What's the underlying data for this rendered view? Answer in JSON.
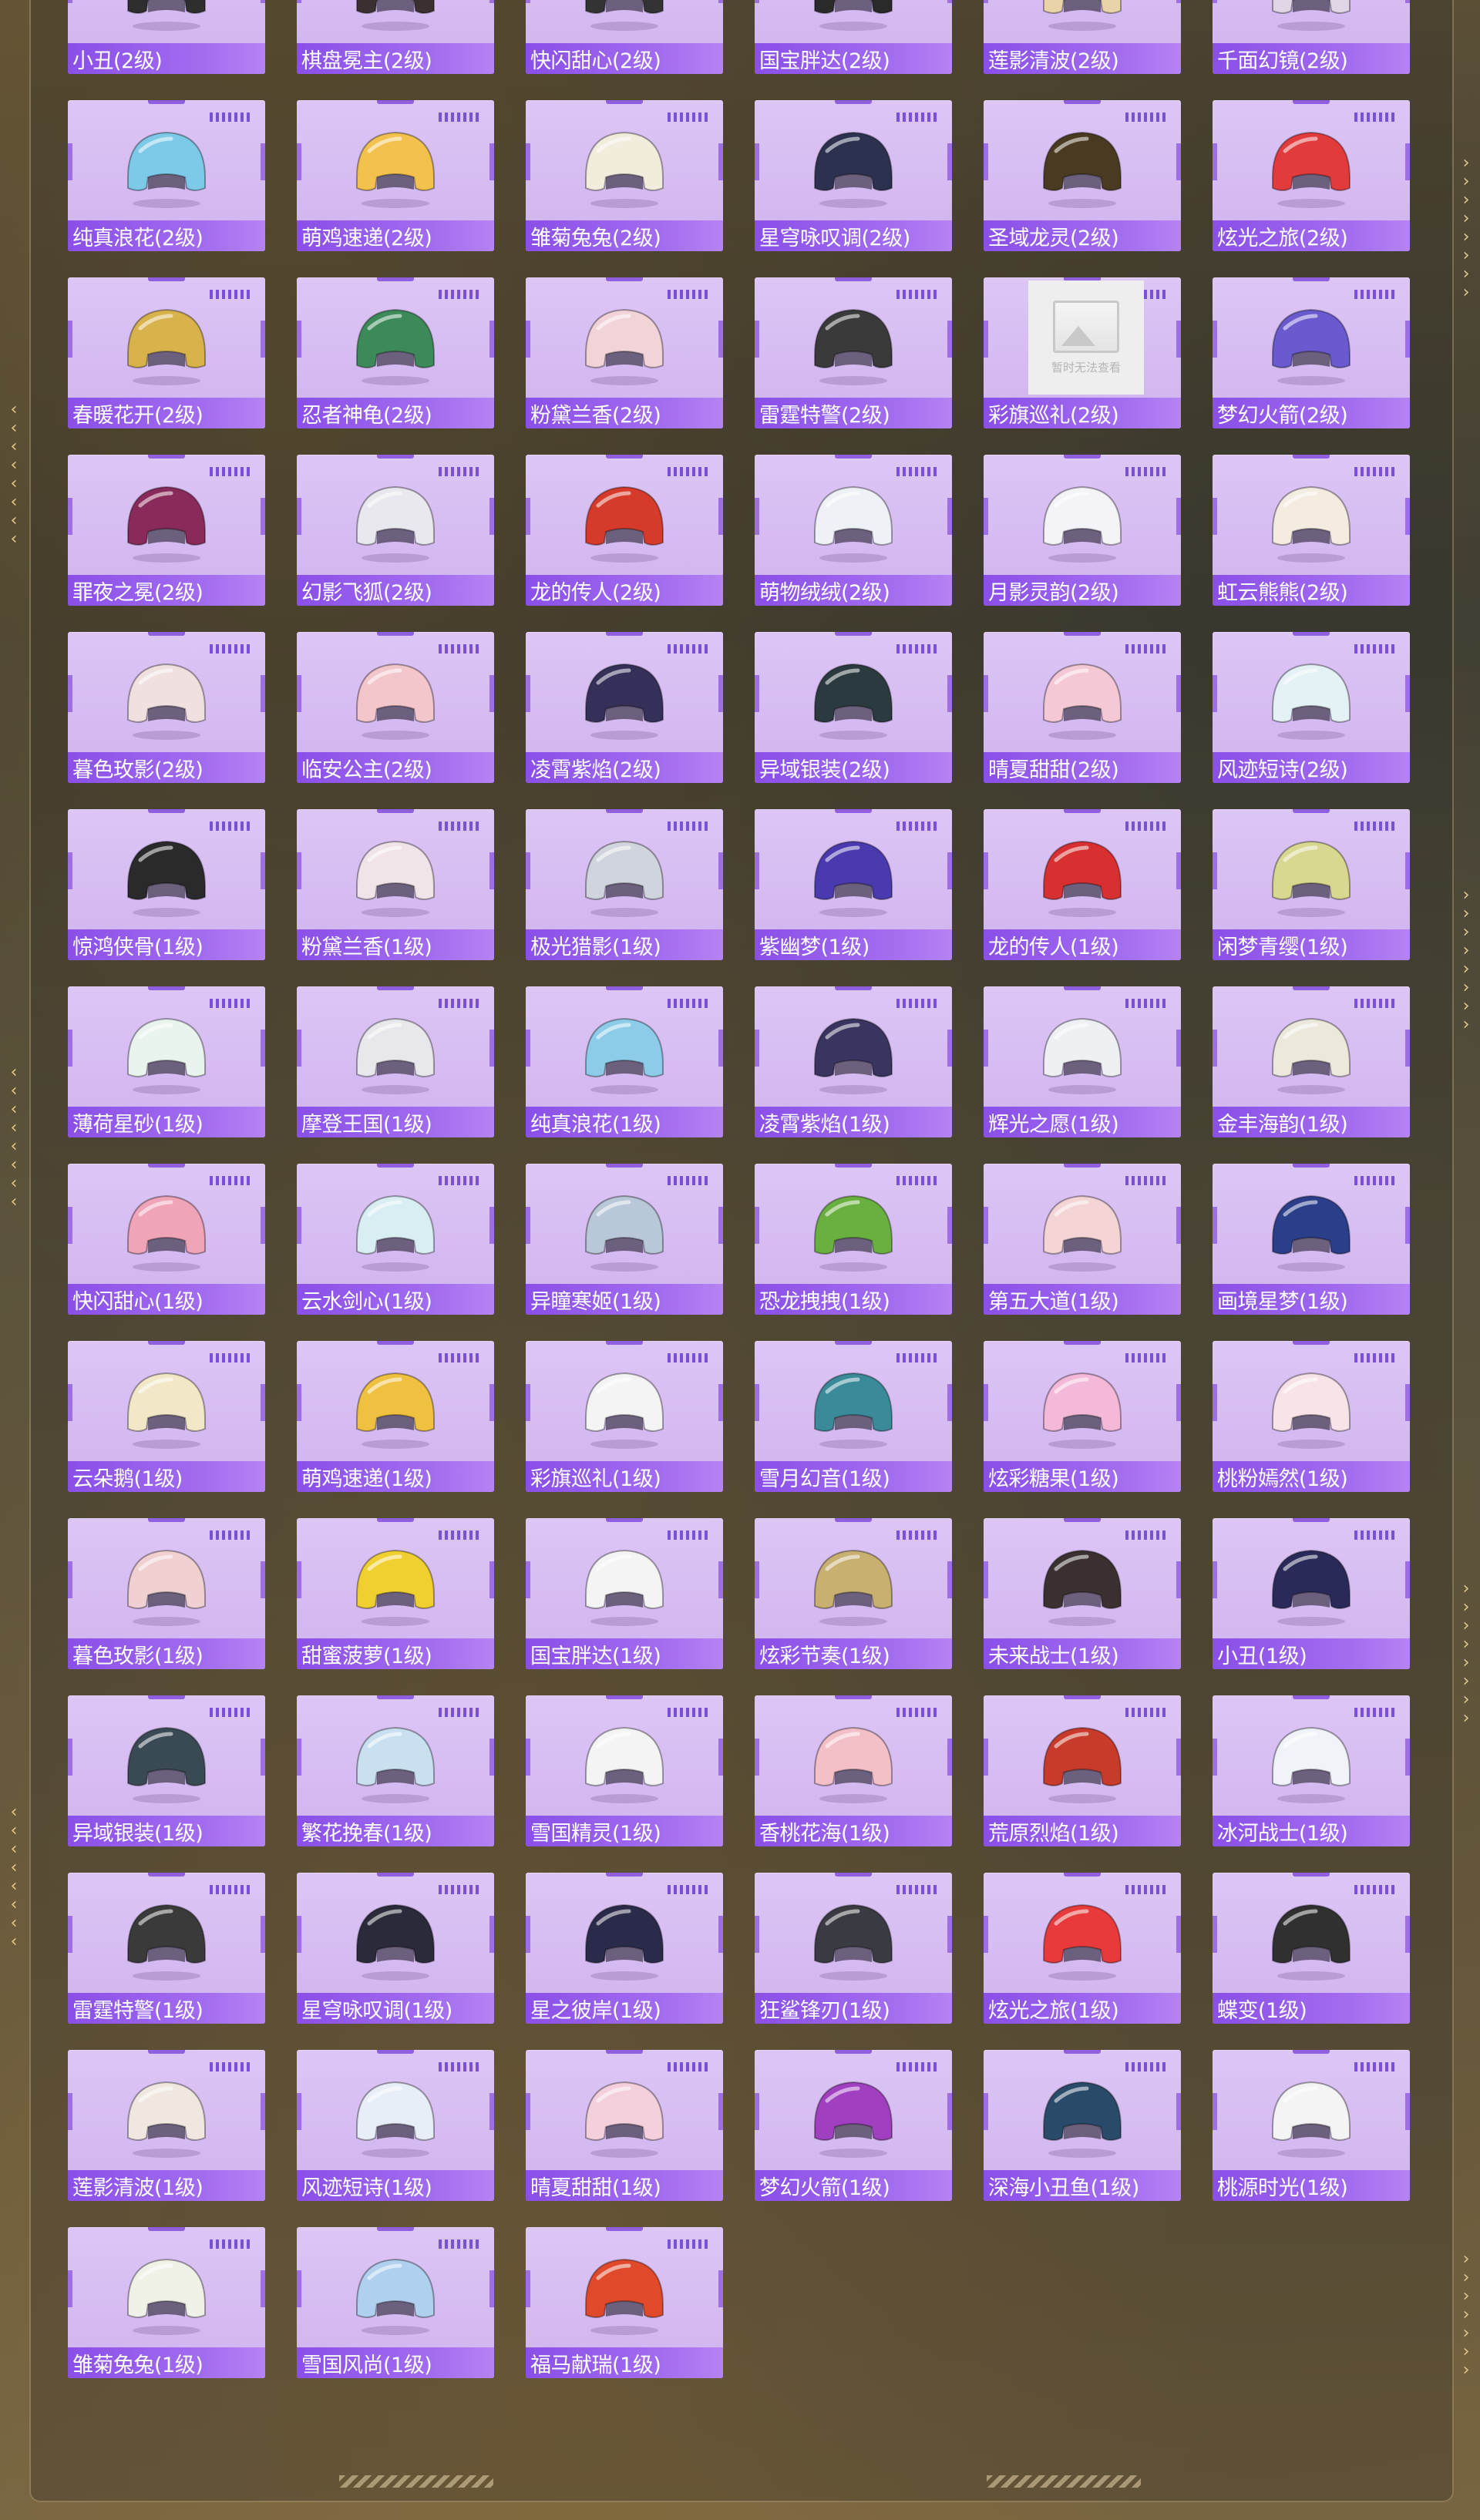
{
  "colors": {
    "card_bg": "#d6bcf2",
    "label_bar": "#8a4fe8",
    "label_text": "#ffffff",
    "accent": "#7b50d8"
  },
  "placeholder_text": "暂时无法查看",
  "rows": [
    {
      "items": [
        {
          "name": "小丑(2级)",
          "icon": "helmet-icon",
          "color": "#2e2e2e"
        },
        {
          "name": "棋盘冕主(2级)",
          "icon": "helmet-icon",
          "color": "#3a3030"
        },
        {
          "name": "快闪甜心(2级)",
          "icon": "helmet-icon",
          "color": "#333333"
        },
        {
          "name": "国宝胖达(2级)",
          "icon": "helmet-icon",
          "color": "#2a2a2a"
        },
        {
          "name": "莲影清波(2级)",
          "icon": "helmet-icon",
          "color": "#e8d4a8"
        },
        {
          "name": "千面幻镜(2级)",
          "icon": "helmet-icon",
          "color": "#e0d6e6"
        }
      ]
    },
    {
      "items": [
        {
          "name": "纯真浪花(2级)",
          "icon": "helmet-icon",
          "color": "#7cc9e8"
        },
        {
          "name": "萌鸡速递(2级)",
          "icon": "helmet-icon",
          "color": "#f2c14e"
        },
        {
          "name": "雏菊兔兔(2级)",
          "icon": "helmet-icon",
          "color": "#f1ecdc"
        },
        {
          "name": "星穹咏叹调(2级)",
          "icon": "helmet-icon",
          "color": "#2c3150"
        },
        {
          "name": "圣域龙灵(2级)",
          "icon": "helmet-icon",
          "color": "#4a3a22"
        },
        {
          "name": "炫光之旅(2级)",
          "icon": "helmet-icon",
          "color": "#e23b3b"
        }
      ]
    },
    {
      "items": [
        {
          "name": "春暖花开(2级)",
          "icon": "helmet-icon",
          "color": "#d8b24a"
        },
        {
          "name": "忍者神龟(2级)",
          "icon": "helmet-icon",
          "color": "#3c8a5a"
        },
        {
          "name": "粉黛兰香(2级)",
          "icon": "helmet-icon",
          "color": "#f2d3d8"
        },
        {
          "name": "雷霆特警(2级)",
          "icon": "helmet-icon",
          "color": "#3a3a3a"
        },
        {
          "name": "彩旗巡礼(2级)",
          "icon": "image-placeholder-icon",
          "color": "#eeeeee"
        },
        {
          "name": "梦幻火箭(2级)",
          "icon": "helmet-icon",
          "color": "#6a5ad0"
        }
      ]
    },
    {
      "items": [
        {
          "name": "罪夜之冕(2级)",
          "icon": "helmet-icon",
          "color": "#8a2a5a"
        },
        {
          "name": "幻影飞狐(2级)",
          "icon": "helmet-icon",
          "color": "#e8e8ee"
        },
        {
          "name": "龙的传人(2级)",
          "icon": "helmet-icon",
          "color": "#d63a2a"
        },
        {
          "name": "萌物绒绒(2级)",
          "icon": "helmet-icon",
          "color": "#eef2f6"
        },
        {
          "name": "月影灵韵(2级)",
          "icon": "helmet-icon",
          "color": "#f4f4f8"
        },
        {
          "name": "虹云熊熊(2级)",
          "icon": "helmet-icon",
          "color": "#f4ece0"
        }
      ]
    },
    {
      "items": [
        {
          "name": "暮色玫影(2级)",
          "icon": "helmet-icon",
          "color": "#f0e0e0"
        },
        {
          "name": "临安公主(2级)",
          "icon": "helmet-icon",
          "color": "#f3c6cc"
        },
        {
          "name": "凌霄紫焰(2级)",
          "icon": "helmet-icon",
          "color": "#35305a"
        },
        {
          "name": "异域银装(2级)",
          "icon": "helmet-icon",
          "color": "#2a3a3e"
        },
        {
          "name": "晴夏甜甜(2级)",
          "icon": "helmet-icon",
          "color": "#f4c8d4"
        },
        {
          "name": "风迹短诗(2级)",
          "icon": "helmet-icon",
          "color": "#e4f2f6"
        }
      ]
    },
    {
      "items": [
        {
          "name": "惊鸿侠骨(1级)",
          "icon": "helmet-icon",
          "color": "#2a2a2a"
        },
        {
          "name": "粉黛兰香(1级)",
          "icon": "helmet-icon",
          "color": "#f0e4e8"
        },
        {
          "name": "极光猎影(1级)",
          "icon": "helmet-icon",
          "color": "#d0d4dc"
        },
        {
          "name": "紫幽梦(1级)",
          "icon": "helmet-icon",
          "color": "#4a3ab0"
        },
        {
          "name": "龙的传人(1级)",
          "icon": "helmet-icon",
          "color": "#d83030"
        },
        {
          "name": "闲梦青缨(1级)",
          "icon": "helmet-icon",
          "color": "#d8d890"
        }
      ]
    },
    {
      "items": [
        {
          "name": "薄荷星砂(1级)",
          "icon": "helmet-icon",
          "color": "#eaf4ee"
        },
        {
          "name": "摩登王国(1级)",
          "icon": "helmet-icon",
          "color": "#e8e8ec"
        },
        {
          "name": "纯真浪花(1级)",
          "icon": "helmet-icon",
          "color": "#8ccce8"
        },
        {
          "name": "凌霄紫焰(1级)",
          "icon": "helmet-icon",
          "color": "#3a3460"
        },
        {
          "name": "辉光之愿(1级)",
          "icon": "helmet-icon",
          "color": "#eef0f4"
        },
        {
          "name": "金丰海韵(1级)",
          "icon": "helmet-icon",
          "color": "#ece8dc"
        }
      ]
    },
    {
      "items": [
        {
          "name": "快闪甜心(1级)",
          "icon": "helmet-icon",
          "color": "#f0a4b8"
        },
        {
          "name": "云水剑心(1级)",
          "icon": "helmet-icon",
          "color": "#d8eef2"
        },
        {
          "name": "异瞳寒姬(1级)",
          "icon": "helmet-icon",
          "color": "#b8c8d8"
        },
        {
          "name": "恐龙拽拽(1级)",
          "icon": "helmet-icon",
          "color": "#6ab040"
        },
        {
          "name": "第五大道(1级)",
          "icon": "helmet-icon",
          "color": "#f4d4d4"
        },
        {
          "name": "画境星梦(1级)",
          "icon": "helmet-icon",
          "color": "#2a3e8a"
        }
      ]
    },
    {
      "items": [
        {
          "name": "云朵鹅(1级)",
          "icon": "helmet-icon",
          "color": "#f2e8c8"
        },
        {
          "name": "萌鸡速递(1级)",
          "icon": "helmet-icon",
          "color": "#f0c040"
        },
        {
          "name": "彩旗巡礼(1级)",
          "icon": "helmet-icon",
          "color": "#f4f4f4"
        },
        {
          "name": "雪月幻音(1级)",
          "icon": "helmet-icon",
          "color": "#3a8a9a"
        },
        {
          "name": "炫彩糖果(1级)",
          "icon": "helmet-icon",
          "color": "#f4b8d8"
        },
        {
          "name": "桃粉嫣然(1级)",
          "icon": "helmet-icon",
          "color": "#f8e4e8"
        }
      ]
    },
    {
      "items": [
        {
          "name": "暮色玫影(1级)",
          "icon": "helmet-icon",
          "color": "#f0d0d0"
        },
        {
          "name": "甜蜜菠萝(1级)",
          "icon": "helmet-icon",
          "color": "#f0d030"
        },
        {
          "name": "国宝胖达(1级)",
          "icon": "helmet-icon",
          "color": "#f4f4f4"
        },
        {
          "name": "炫彩节奏(1级)",
          "icon": "helmet-icon",
          "color": "#c8b070"
        },
        {
          "name": "未来战士(1级)",
          "icon": "helmet-icon",
          "color": "#3a3030"
        },
        {
          "name": "小丑(1级)",
          "icon": "helmet-icon",
          "color": "#2a2a5a"
        }
      ]
    },
    {
      "items": [
        {
          "name": "异域银装(1级)",
          "icon": "helmet-icon",
          "color": "#3a4a54"
        },
        {
          "name": "繁花挽春(1级)",
          "icon": "helmet-icon",
          "color": "#c8e0f0"
        },
        {
          "name": "雪国精灵(1级)",
          "icon": "helmet-icon",
          "color": "#f4f4f4"
        },
        {
          "name": "香桃花海(1级)",
          "icon": "helmet-icon",
          "color": "#f4c0c8"
        },
        {
          "name": "荒原烈焰(1级)",
          "icon": "helmet-icon",
          "color": "#c83a2a"
        },
        {
          "name": "冰河战士(1级)",
          "icon": "helmet-icon",
          "color": "#f0f4f8"
        }
      ]
    },
    {
      "items": [
        {
          "name": "雷霆特警(1级)",
          "icon": "helmet-icon",
          "color": "#3a3a3a"
        },
        {
          "name": "星穹咏叹调(1级)",
          "icon": "helmet-icon",
          "color": "#2a2a3a"
        },
        {
          "name": "星之彼岸(1级)",
          "icon": "helmet-icon",
          "color": "#2a2a4a"
        },
        {
          "name": "狂鲨锋刃(1级)",
          "icon": "helmet-icon",
          "color": "#3a3a42"
        },
        {
          "name": "炫光之旅(1级)",
          "icon": "helmet-icon",
          "color": "#e83a3a"
        },
        {
          "name": "蝶变(1级)",
          "icon": "helmet-icon",
          "color": "#303030"
        }
      ]
    },
    {
      "items": [
        {
          "name": "莲影清波(1级)",
          "icon": "helmet-icon",
          "color": "#f0e8e0"
        },
        {
          "name": "风迹短诗(1级)",
          "icon": "helmet-icon",
          "color": "#e8eef8"
        },
        {
          "name": "晴夏甜甜(1级)",
          "icon": "helmet-icon",
          "color": "#f4d0dc"
        },
        {
          "name": "梦幻火箭(1级)",
          "icon": "helmet-icon",
          "color": "#a040c0"
        },
        {
          "name": "深海小丑鱼(1级)",
          "icon": "helmet-icon",
          "color": "#2a4a6a"
        },
        {
          "name": "桃源时光(1级)",
          "icon": "helmet-icon",
          "color": "#f4f4f4"
        }
      ]
    },
    {
      "items": [
        {
          "name": "雏菊兔兔(1级)",
          "icon": "helmet-icon",
          "color": "#f0f2e8"
        },
        {
          "name": "雪国风尚(1级)",
          "icon": "helmet-icon",
          "color": "#b0d0f0"
        },
        {
          "name": "福马献瑞(1级)",
          "icon": "helmet-icon",
          "color": "#e04a2a"
        }
      ]
    }
  ]
}
